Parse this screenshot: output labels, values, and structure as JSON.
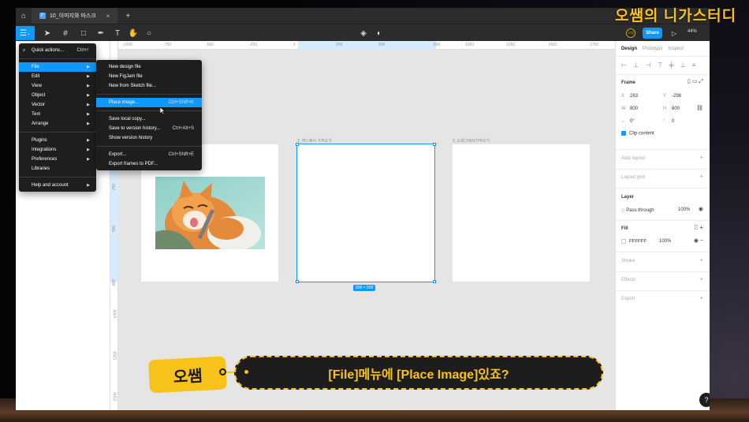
{
  "tabbar": {
    "home_icon": "home-icon",
    "file_tab": "10_이미지와 마스크",
    "close": "×",
    "add": "+"
  },
  "toolbar": {
    "share": "Share",
    "zoom": "44%",
    "avatar": "오쌤"
  },
  "rulers": {
    "top": [
      "-1000",
      "-750",
      "-500",
      "-250",
      "0",
      "250",
      "500",
      "800",
      "1000",
      "1250",
      "1500",
      "1750"
    ],
    "left": [
      "250",
      "500",
      "800",
      "1000",
      "1250",
      "1500"
    ]
  },
  "canvas": {
    "frame2_label": "2_캐느에서 가져오기",
    "frame3_label": "3_드래그에서가져오기",
    "dimensions": "800 × 800"
  },
  "main_menu": {
    "items": [
      {
        "label": "Quick actions...",
        "shortcut": "Ctrl+/"
      },
      {
        "label": "File"
      },
      {
        "label": "Edit"
      },
      {
        "label": "View"
      },
      {
        "label": "Object"
      },
      {
        "label": "Vector"
      },
      {
        "label": "Text"
      },
      {
        "label": "Arrange"
      },
      {
        "label": "Plugins"
      },
      {
        "label": "Integrations"
      },
      {
        "label": "Preferences"
      },
      {
        "label": "Libraries"
      },
      {
        "label": "Help and account"
      }
    ]
  },
  "file_menu": {
    "items": [
      {
        "label": "New design file",
        "shortcut": ""
      },
      {
        "label": "New FigJam file",
        "shortcut": ""
      },
      {
        "label": "New from Sketch file...",
        "shortcut": ""
      },
      {
        "label": "Place image...",
        "shortcut": "Ctrl+Shift+K"
      },
      {
        "label": "Save local copy...",
        "shortcut": ""
      },
      {
        "label": "Save to version history...",
        "shortcut": "Ctrl+Alt+S"
      },
      {
        "label": "Show version history",
        "shortcut": ""
      },
      {
        "label": "Export...",
        "shortcut": "Ctrl+Shift+E"
      },
      {
        "label": "Export frames to PDF...",
        "shortcut": ""
      }
    ]
  },
  "right_panel": {
    "tabs": [
      "Design",
      "Prototype",
      "Inspect"
    ],
    "frame_title": "Frame",
    "x_label": "X",
    "x_value": "263",
    "y_label": "Y",
    "y_value": "-298",
    "w_label": "W",
    "w_value": "800",
    "h_label": "H",
    "h_value": "800",
    "rotation": "0°",
    "radius": "0",
    "clip_content": "Clip content",
    "auto_layout": "Auto layout",
    "layout_grid": "Layout grid",
    "layer": "Layer",
    "pass_through": "Pass through",
    "layer_opacity": "100%",
    "fill": "Fill",
    "fill_hex": "FFFFFF",
    "fill_opacity": "100%",
    "stroke": "Stroke",
    "effects": "Effects",
    "export": "Export"
  },
  "overlay": {
    "watermark": "오쌤의 니가스터디",
    "badge": "오쌤",
    "caption": "[File]메뉴에 [Place Image]있죠?",
    "help": "?"
  },
  "colors": {
    "accent": "#0d99ff",
    "brand_yellow": "#f7c31b",
    "menu_bg": "#1e1e1e"
  }
}
